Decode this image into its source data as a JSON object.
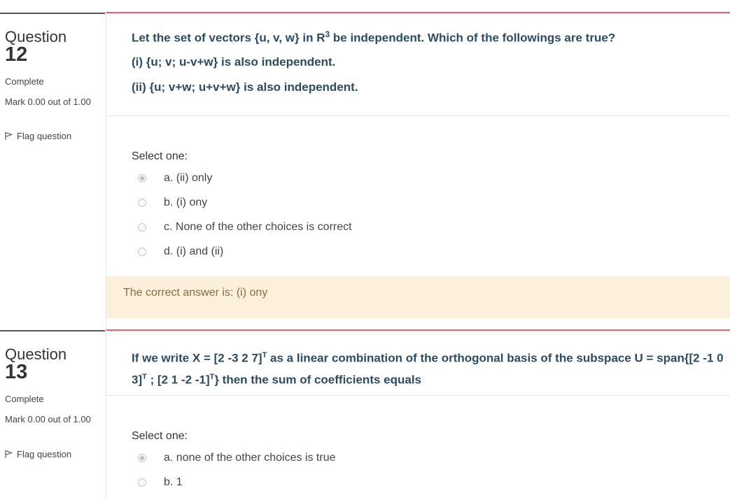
{
  "q12": {
    "label": "Question",
    "number": "12",
    "state": "Complete",
    "grade": "Mark 0.00 out of 1.00",
    "flag": "Flag question",
    "text_main": "Let the set of vectors {u, v, w} in R",
    "text_sup": "3",
    "text_end": " be independent. Which of the followings are true?",
    "line_i": "(i) {u; v; u-v+w} is also independent.",
    "line_ii": "(ii) {u; v+w; u+v+w} is also independent.",
    "prompt": "Select one:",
    "options": [
      "a. (ii) only",
      "b. (i) ony",
      "c. None of the other choices is correct",
      "d. (i) and (ii)"
    ],
    "checked": 0,
    "feedback": "The correct answer is: (i) ony"
  },
  "q13": {
    "label": "Question",
    "number": "13",
    "state": "Complete",
    "grade": "Mark 0.00 out of 1.00",
    "flag": "Flag question",
    "t1": "If we write X = [2 -3 2 7]",
    "t1sup": "T",
    "t2": " as a linear combination of the orthogonal basis of the subspace U = span{[2 -1 0 3]",
    "t2sup": "T",
    "t3": " ; [2 1 -2 -1]",
    "t3sup": "T",
    "t4": "} then the sum of coefficients equals",
    "prompt": "Select one:",
    "options": [
      "a. none of the other choices is true",
      "b. 1"
    ],
    "checked": 0
  },
  "colors": {
    "accent_line": "#e9636f",
    "question_text": "#2a4b62",
    "feedback_bg": "#fcefdc"
  },
  "icons": {
    "flag": "flag-icon",
    "radio": "radio-button"
  }
}
